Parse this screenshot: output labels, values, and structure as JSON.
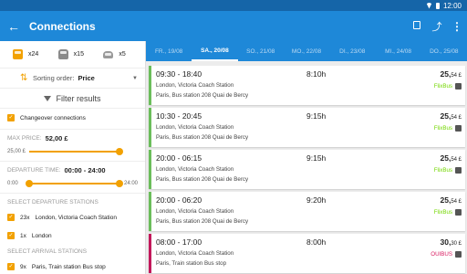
{
  "status": {
    "time": "12:00"
  },
  "appbar": {
    "title": "Connections",
    "back_icon": "arrow-back-icon",
    "actions": [
      "map-icon",
      "share-icon",
      "more-vert-icon"
    ]
  },
  "filters": {
    "modes": [
      {
        "icon": "bus-icon",
        "count": "x24"
      },
      {
        "icon": "train-icon",
        "count": "x15"
      },
      {
        "icon": "car-icon",
        "count": "x5"
      }
    ],
    "sorting": {
      "label": "Sorting order:",
      "value": "Price"
    },
    "header": "Filter results",
    "changeover": "Changeover connections",
    "max_price": {
      "label": "MAX PRICE:",
      "value": "52,00 £",
      "min": "25,00 £",
      "fraction": 1.0
    },
    "departure_time": {
      "label": "DEPARTURE TIME:",
      "value": "00:00 - 24:00",
      "min": "0:00",
      "max": "24:00",
      "from": 0.0,
      "to": 1.0
    },
    "departure_stations_label": "SELECT DEPARTURE STATIONS",
    "departure_stations": [
      {
        "count": "23x",
        "name": "London, Victoria Coach Station"
      },
      {
        "count": "1x",
        "name": "London"
      }
    ],
    "arrival_stations_label": "SELECT ARRIVAL STATIONS",
    "arrival_stations": [
      {
        "count": "9x",
        "name": "Paris, Train station Bus stop"
      }
    ]
  },
  "dates": [
    "FR., 19/08",
    "SA., 20/08",
    "SO., 21/08",
    "MO., 22/08",
    "DI., 23/08",
    "MI., 24/08",
    "DO., 25/08"
  ],
  "active_date_index": 1,
  "connections": [
    {
      "time": "09:30 - 18:40",
      "duration": "8:10h",
      "price": "25,",
      "cents": "54 £",
      "from": "London, Victoria Coach Station",
      "to": "Paris, Bus station 208 Quai de Bercy",
      "operator": "FlixBus",
      "color": "#6bbd5b"
    },
    {
      "time": "10:30 - 20:45",
      "duration": "9:15h",
      "price": "25,",
      "cents": "54 £",
      "from": "London, Victoria Coach Station",
      "to": "Paris, Bus station 208 Quai de Bercy",
      "operator": "FlixBus",
      "color": "#6bbd5b"
    },
    {
      "time": "20:00 - 06:15",
      "duration": "9:15h",
      "price": "25,",
      "cents": "54 £",
      "from": "London, Victoria Coach Station",
      "to": "Paris, Bus station 208 Quai de Bercy",
      "operator": "FlixBus",
      "color": "#6bbd5b"
    },
    {
      "time": "20:00 - 06:20",
      "duration": "9:20h",
      "price": "25,",
      "cents": "54 £",
      "from": "London, Victoria Coach Station",
      "to": "Paris, Bus station 208 Quai de Bercy",
      "operator": "FlixBus",
      "color": "#6bbd5b"
    },
    {
      "time": "08:00 - 17:00",
      "duration": "8:00h",
      "price": "30,",
      "cents": "30 £",
      "from": "London, Victoria Coach Station",
      "to": "Paris, Train station Bus stop",
      "operator": "OUIBUS",
      "color": "#c2185b"
    }
  ]
}
